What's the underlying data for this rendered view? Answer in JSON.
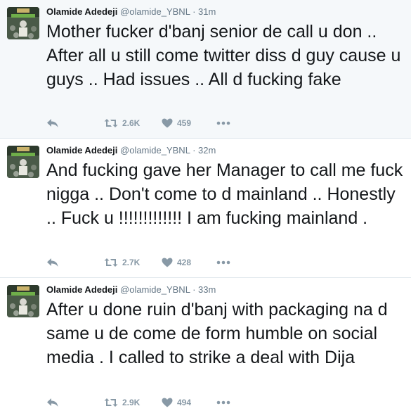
{
  "tweets": [
    {
      "name": "Olamide Adedeji",
      "handle": "@olamide_YBNL",
      "separator": "·",
      "time": "31m",
      "text": "Mother fucker d'banj senior de call u don .. After all u still come twitter diss d guy cause u guys .. Had issues .. All d fucking fake",
      "retweets": "2.6K",
      "likes": "459"
    },
    {
      "name": "Olamide Adedeji",
      "handle": "@olamide_YBNL",
      "separator": "·",
      "time": "32m",
      "text": "And fucking gave her Manager to call me fuck nigga .. Don't come to d mainland .. Honestly .. Fuck u !!!!!!!!!!!!! I am fucking mainland .",
      "retweets": "2.7K",
      "likes": "428"
    },
    {
      "name": "Olamide Adedeji",
      "handle": "@olamide_YBNL",
      "separator": "·",
      "time": "33m",
      "text": "After u done ruin d'banj with packaging na d same u de come de form humble on social media . I called to strike a deal with Dija",
      "retweets": "2.9K",
      "likes": "494"
    }
  ],
  "icons": {
    "reply": "reply-icon",
    "retweet": "retweet-icon",
    "like": "heart-icon",
    "more": "more-dots-icon"
  },
  "colors": {
    "action_gray": "#8899a6",
    "secondary_text": "#657786",
    "highlight_background": "#f5f8fa"
  }
}
